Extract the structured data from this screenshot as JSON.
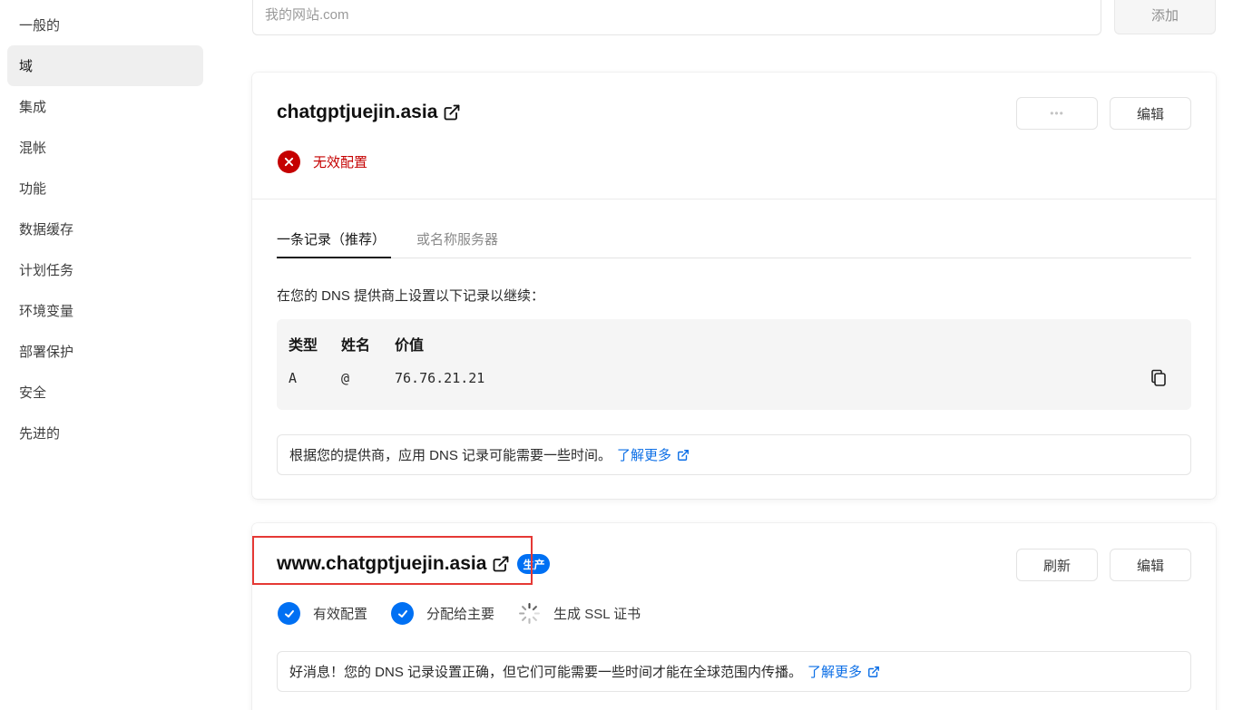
{
  "sidebar": {
    "items": [
      {
        "label": "一般的",
        "active": false
      },
      {
        "label": "域",
        "active": true
      },
      {
        "label": "集成",
        "active": false
      },
      {
        "label": "混帐",
        "active": false
      },
      {
        "label": "功能",
        "active": false
      },
      {
        "label": "数据缓存",
        "active": false
      },
      {
        "label": "计划任务",
        "active": false
      },
      {
        "label": "环境变量",
        "active": false
      },
      {
        "label": "部署保护",
        "active": false
      },
      {
        "label": "安全",
        "active": false
      },
      {
        "label": "先进的",
        "active": false
      }
    ]
  },
  "add_domain": {
    "placeholder": "我的网站.com",
    "button_label": "添加"
  },
  "domains": [
    {
      "name": "chatgptjuejin.asia",
      "more_button": "•••",
      "edit_button": "编辑",
      "status": {
        "label": "无效配置",
        "type": "error"
      },
      "tabs": [
        {
          "label": "一条记录（推荐）",
          "active": true
        },
        {
          "label": "或名称服务器",
          "active": false
        }
      ],
      "instruction": "在您的 DNS 提供商上设置以下记录以继续：",
      "dns_table": {
        "headers": [
          "类型",
          "姓名",
          "价值"
        ],
        "rows": [
          [
            "A",
            "@",
            "76.76.21.21"
          ]
        ]
      },
      "note": "根据您的提供商，应用 DNS 记录可能需要一些时间。",
      "learn_more": "了解更多"
    },
    {
      "name": "www.chatgptjuejin.asia",
      "badge": "生产",
      "refresh_button": "刷新",
      "edit_button": "编辑",
      "statuses": [
        {
          "label": "有效配置",
          "type": "success"
        },
        {
          "label": "分配给主要",
          "type": "success"
        },
        {
          "label": "生成 SSL 证书",
          "type": "loading"
        }
      ],
      "note": "好消息！您的 DNS 记录设置正确，但它们可能需要一些时间才能在全球范围内传播。",
      "learn_more": "了解更多"
    }
  ],
  "colors": {
    "accent": "#0070f3",
    "error": "#c50000",
    "success": "#0070f3",
    "link": "#0b6ee6",
    "highlight": "#e53935"
  }
}
